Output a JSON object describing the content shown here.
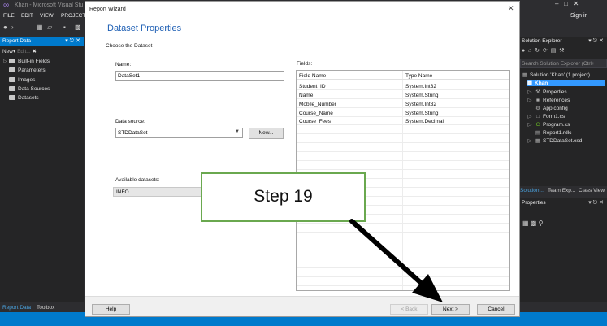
{
  "vs": {
    "window_title": "Khan - Microsoft Visual Stu",
    "menu": [
      "FILE",
      "EDIT",
      "VIEW",
      "PROJECT"
    ],
    "sign_in": "Sign in",
    "report_data_panel": {
      "title": "Report Data",
      "tools": "New",
      "tools_disabled": "Edit...",
      "items": [
        "Built-in Fields",
        "Parameters",
        "Images",
        "Data Sources",
        "Datasets"
      ]
    },
    "bottom_tabs": [
      "Report Data",
      "Toolbox"
    ],
    "solution_explorer": {
      "title": "Solution Explorer",
      "search_placeholder": "Search Solution Explorer (Ctrl+",
      "items": [
        "Solution 'Khan' (1 project)",
        "Khan",
        "Properties",
        "References",
        "App.config",
        "Form1.cs",
        "Program.cs",
        "Report1.rdlc",
        "STDDataSet.xsd"
      ],
      "tabs": [
        "Solution...",
        "Team Exp...",
        "Class View"
      ]
    },
    "properties_panel": {
      "title": "Properties"
    }
  },
  "wizard": {
    "title": "Report Wizard",
    "heading": "Dataset Properties",
    "subheading": "Choose the Dataset",
    "name_label": "Name:",
    "name_value": "DataSet1",
    "datasource_label": "Data source:",
    "datasource_value": "STDDataSet",
    "new_button": "New...",
    "available_label": "Available datasets:",
    "available_value": "INFO",
    "fields_label": "Fields:",
    "fields_columns": [
      "Field Name",
      "Type Name"
    ],
    "fields": [
      [
        "Student_ID",
        "System.Int32"
      ],
      [
        "Name",
        "System.String"
      ],
      [
        "Mobile_Number",
        "System.Int32"
      ],
      [
        "Course_Name",
        "System.String"
      ],
      [
        "Course_Fees",
        "System.Decimal"
      ]
    ],
    "buttons": {
      "help": "Help",
      "back": "< Back",
      "next": "Next >",
      "cancel": "Cancel"
    }
  },
  "annotation": {
    "step": "Step 19"
  },
  "colors": {
    "vs_accent": "#007acc",
    "wizard_heading": "#1e5fb4",
    "callout_border": "#6aa84f"
  }
}
